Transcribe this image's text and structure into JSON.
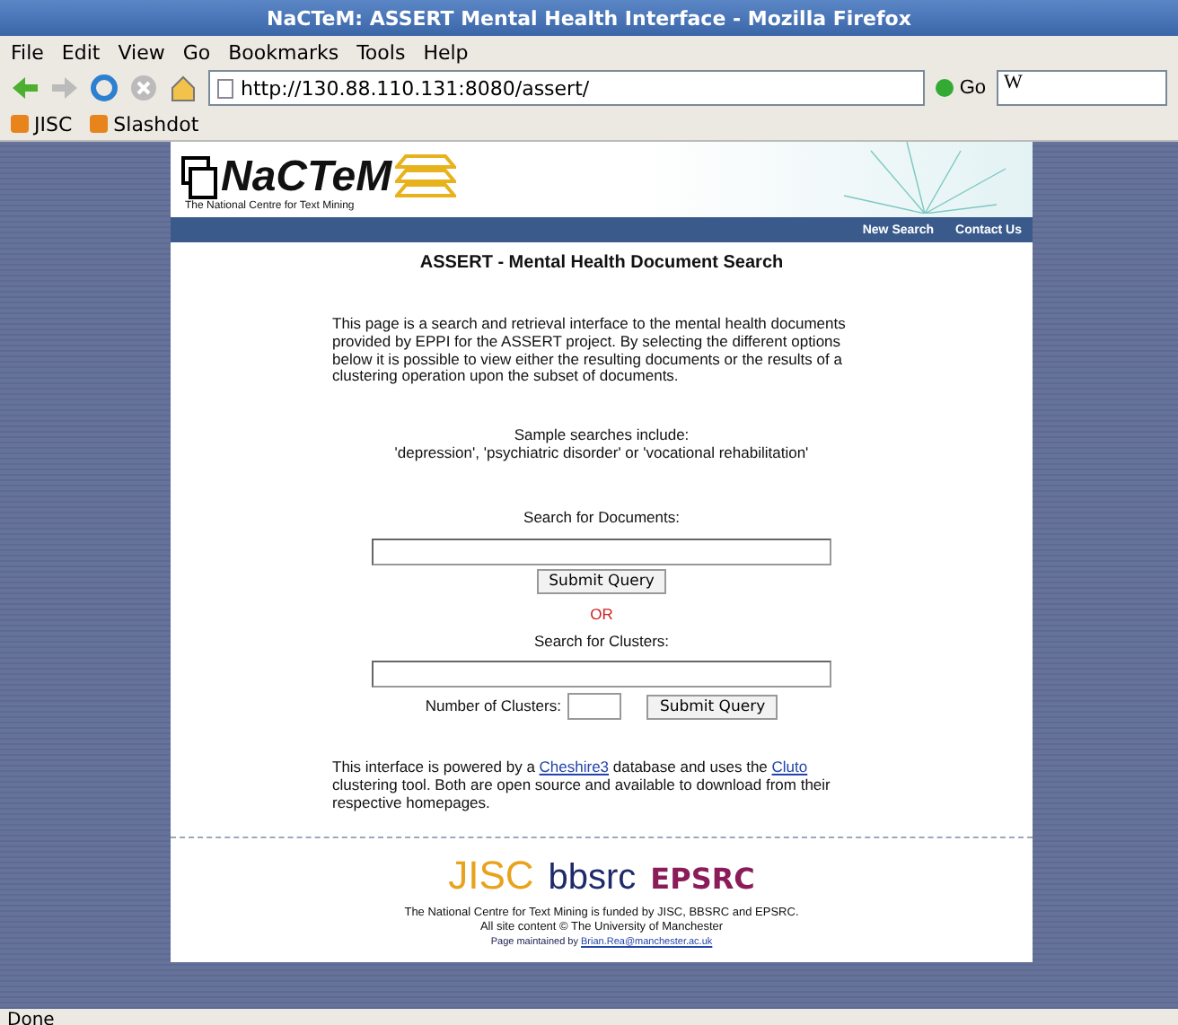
{
  "window": {
    "title": "NaCTeM: ASSERT Mental Health Interface - Mozilla Firefox"
  },
  "menu": [
    "File",
    "Edit",
    "View",
    "Go",
    "Bookmarks",
    "Tools",
    "Help"
  ],
  "toolbar": {
    "url": "http://130.88.110.131:8080/assert/",
    "go": "Go",
    "search_engine": "W"
  },
  "bookmarks": [
    "JISC",
    "Slashdot"
  ],
  "page": {
    "logo": {
      "name": "NaCTeM",
      "tagline": "The National Centre for Text Mining"
    },
    "nav": [
      "New Search",
      "Contact Us"
    ],
    "heading": "ASSERT - Mental Health Document Search",
    "intro": "This page is a search and retrieval interface to the mental health documents provided by EPPI for the ASSERT project. By selecting the different options below it is possible to view either the resulting documents or the results of a clustering operation upon the subset of documents.",
    "samples": [
      "Sample searches include:",
      "'depression', 'psychiatric disorder' or 'vocational rehabilitation'"
    ],
    "doc_search": {
      "label": "Search for Documents:",
      "button": "Submit Query"
    },
    "or": "OR",
    "cluster_search": {
      "label": "Search for Clusters:",
      "count_label": "Number of Clusters:",
      "button": "Submit Query"
    },
    "powered": {
      "before": "This interface is powered by a ",
      "link1": "Cheshire3",
      "middle": " database and uses the ",
      "link2": "Cluto",
      "after": " clustering tool. Both are open source and available to download from their respective homepages."
    },
    "funders": [
      "JISC",
      "bbsrc",
      "EPSRC"
    ],
    "funded": "The National Centre for Text Mining is funded by JISC, BBSRC and EPSRC.",
    "copyright": "All site content © The University of Manchester",
    "maintained": {
      "text": "Page maintained by ",
      "link": "Brian.Rea@manchester.ac.uk"
    }
  },
  "status": "Done"
}
